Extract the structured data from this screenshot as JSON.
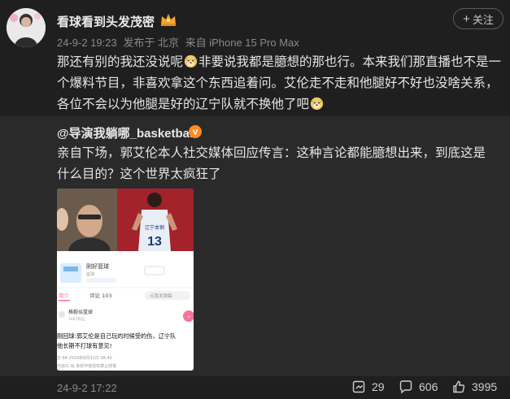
{
  "post": {
    "username": "看球看到头发茂密",
    "meta": {
      "date": "24-9-2 19:23",
      "published_in": "发布于 北京",
      "device": "来自 iPhone 15 Pro Max"
    },
    "follow_label": "关注",
    "text_segments": [
      "那还有别的我还没说呢",
      "非要说我都是臆想的那也行。本来我们那直播也不是一个爆料节目，非喜欢拿这个东西追着问。艾伦走不走和他腿好不好也没啥关系，各位不会以为他腿是好的辽宁队就不换他了吧"
    ]
  },
  "repost": {
    "author": "@导演我躺哪_basketball",
    "text": "亲自下场，郭艾伦本人社交媒体回应传言：这种言论都能臆想出来，到底这是什么目的？这个世界太疯狂了",
    "image": {
      "jersey_text": "辽宁本钢",
      "jersey_number": "13",
      "profile_name": "刚好篮球",
      "profile_sub": "篮球",
      "tab_intro": "简介",
      "tab_comments": "评论 103",
      "comment_button": "点我发弹幕",
      "account_name": "格毅似篮球",
      "account_sub": "1687粉丝",
      "headline_line1": "刚回球:郭艾伦是自己玩的时候受的伤，辽宁队",
      "headline_line2": "他长期不打球有意见!",
      "stats_line": "万  84  2024年8月31日 08:40",
      "footer_line": "内容/C.AJ  未经作者授权禁止转载"
    }
  },
  "footer": {
    "time": "24-9-2 17:22",
    "reposts": "29",
    "comments": "606",
    "likes": "3995"
  }
}
